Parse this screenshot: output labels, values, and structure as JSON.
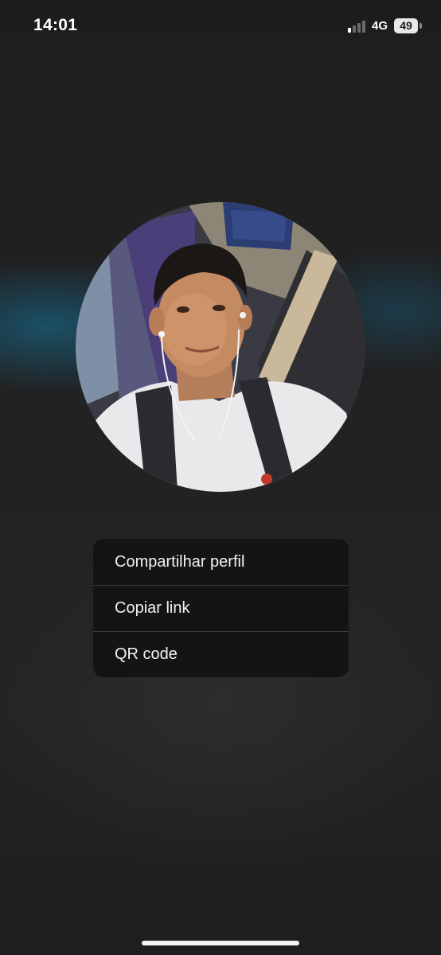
{
  "status_bar": {
    "time": "14:01",
    "network": "4G",
    "battery": "49",
    "signal_bars_active": 1,
    "signal_bars_total": 4
  },
  "avatar": {
    "description_icon": "profile-photo"
  },
  "menu": {
    "items": [
      {
        "label": "Compartilhar perfil"
      },
      {
        "label": "Copiar link"
      },
      {
        "label": "QR code"
      }
    ]
  },
  "colors": {
    "background": "#202020",
    "menu_background": "#141414",
    "menu_divider": "#3a3a3a",
    "menu_text": "#f2f2f2",
    "accent_glow": "#1478a0"
  }
}
